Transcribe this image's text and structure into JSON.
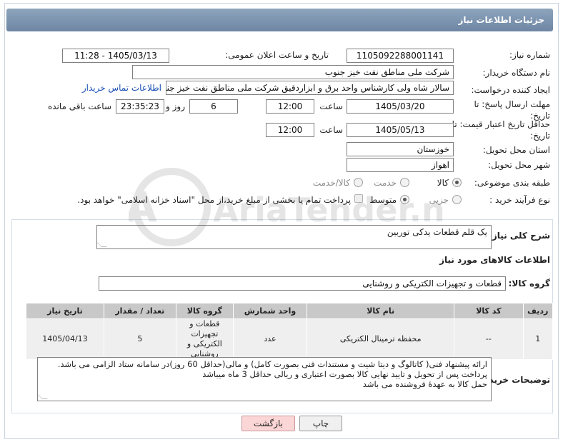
{
  "header": {
    "title": "جزئیات اطلاعات نیاز"
  },
  "labels": {
    "need_number": "شماره نیاز:",
    "announce_datetime": "تاریخ و ساعت اعلان عمومی:",
    "buyer_org": "نام دستگاه خریدار:",
    "requester": "ایجاد کننده درخواست:",
    "reply_deadline": "مهلت ارسال پاسخ: تا تاریخ:",
    "price_validity": "حداقل تاریخ اعتبار قیمت: تا تاریخ:",
    "time": "ساعت",
    "days_and": "روز و",
    "remaining": "ساعت باقی مانده",
    "province": "استان محل تحویل:",
    "city": "شهر محل تحویل:",
    "category": "طبقه بندی موضوعی:",
    "process_type": "نوع فرآیند خرید :",
    "summary": "شرح کلی نیاز:",
    "goods_info": "اطلاعات کالاهای مورد نیاز",
    "goods_group": "گروه کالا:",
    "buyer_notes": "توضیحات خریدار:"
  },
  "fields": {
    "need_number": "1105092288001141",
    "announce_datetime": "1405/03/13 - 11:28",
    "buyer_org": "شرکت ملی مناطق نفت خیز جنوب",
    "requester": "سالار شاه ولی کارشناس واحد برق و ابزاردقیق شرکت ملی مناطق نفت خیز جنوب",
    "contact_link": "اطلاعات تماس خریدار",
    "reply_date": "1405/03/20",
    "reply_time": "12:00",
    "days": "6",
    "remaining_time": "23:35:23",
    "validity_date": "1405/05/13",
    "validity_time": "12:00",
    "province": "خوزستان",
    "city": "اهواز",
    "summary": "یک قلم قطعات یدکی توربین",
    "goods_group": "قطعات و تجهیزات الکتریکی و روشنایی"
  },
  "category_options": [
    "کالا",
    "خدمت",
    "کالا/خدمت"
  ],
  "process_options": [
    "جزیی",
    "متوسط"
  ],
  "payment_note": "پرداخت تمام یا بخشی از مبلغ خرید،از محل \"اسناد خزانه اسلامی\" خواهد بود.",
  "table": {
    "headers": [
      "ردیف",
      "کد کالا",
      "نام کالا",
      "واحد شمارش",
      "گروه کالا",
      "تعداد / مقدار",
      "تاریخ نیاز"
    ],
    "rows": [
      [
        "1",
        "--",
        "محفظه ترمینال الکتریکی",
        "عدد",
        "قطعات و تجهیزات الکتریکی و روشنایی",
        "5",
        "1405/04/13"
      ]
    ]
  },
  "notes": [
    "ارائه پیشنهاد فنی( کاتالوگ و دیتا شیت و مستندات فنی بصورت کامل) و مالی(حداقل 60 روز)در سامانه ستاد الزامی می باشد.",
    "پرداخت پس از تحویل و تایید نهایی کالا بصورت اعتباری و ریالی حداقل 3 ماه میباشد",
    "حمل کالا به عهدهٔ فروشنده می باشد"
  ],
  "buttons": {
    "print": "چاپ",
    "back": "بازگشت"
  },
  "watermark": "AriaTender.net"
}
